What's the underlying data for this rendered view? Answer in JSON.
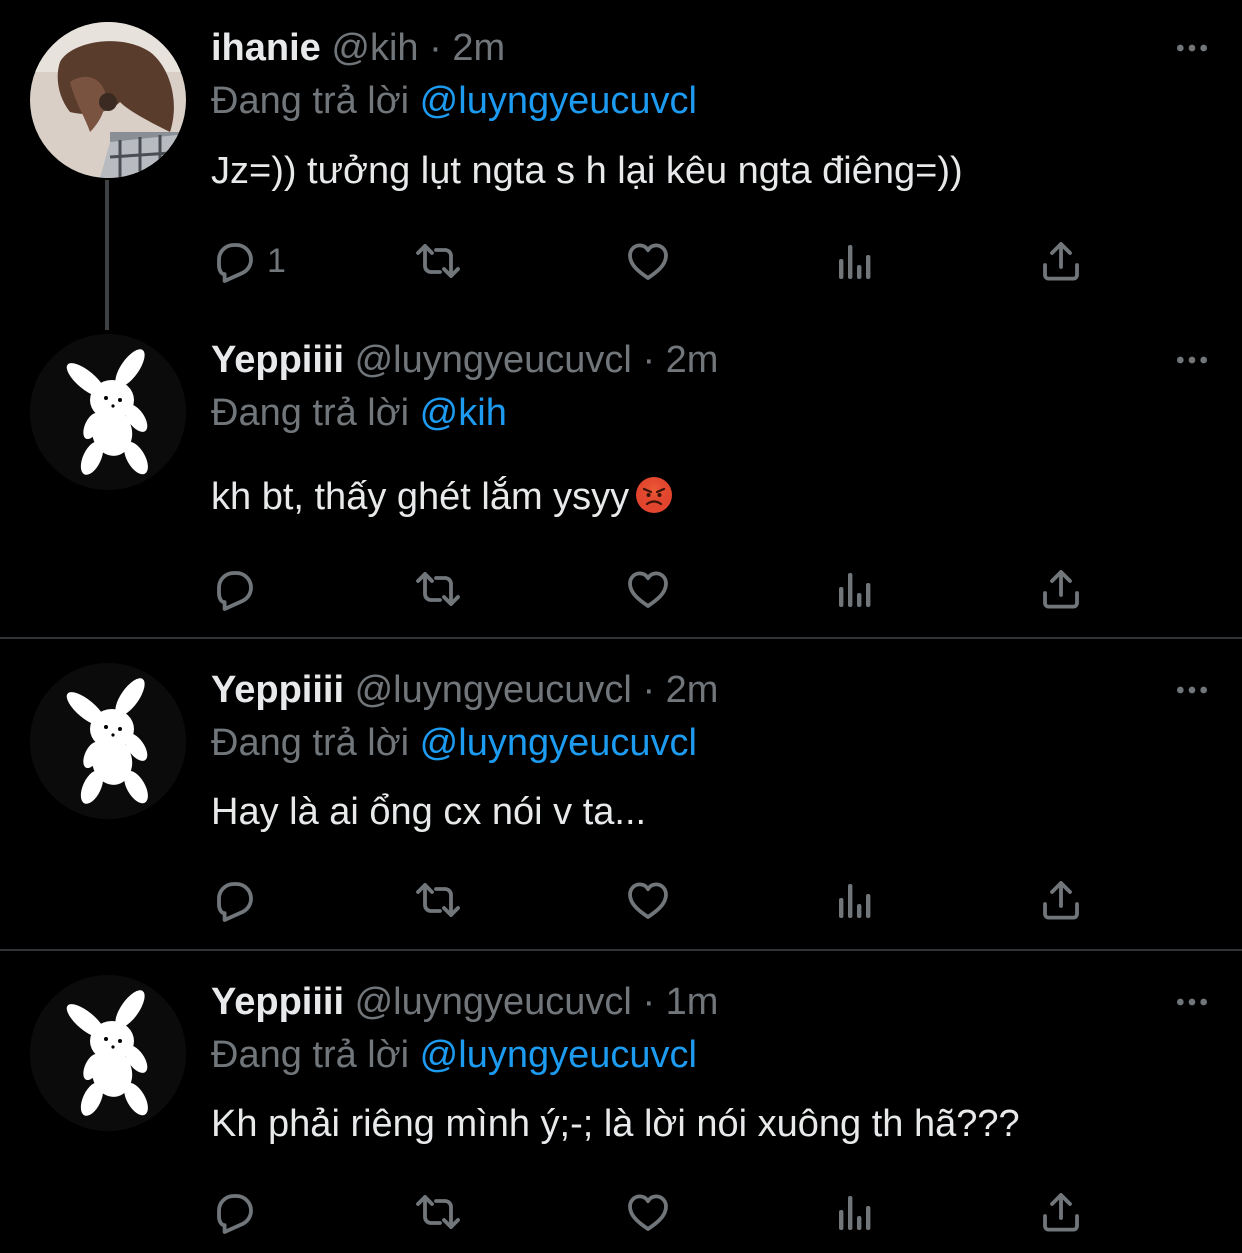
{
  "colors": {
    "background": "#000000",
    "text": "#e7e9ea",
    "muted": "#71767b",
    "mention": "#1d9bf0",
    "divider": "#2f3336"
  },
  "icons": {
    "reply": "reply-icon",
    "retweet": "retweet-icon",
    "like": "heart-icon",
    "views": "views-icon",
    "share": "share-icon",
    "more": "more-icon"
  },
  "tweets": [
    {
      "name": "ihanie",
      "handle": "@kih",
      "time": "2m",
      "reply_label": "Đang trả lời",
      "reply_to": "@luyngyeucuvcl",
      "text": "Jz=)) tưởng lụt ngta s h lại kêu ngta điêng=))",
      "reply_count": "1"
    },
    {
      "name": "Yeppiiii",
      "handle": "@luyngyeucuvcl",
      "time": "2m",
      "reply_label": "Đang trả lời",
      "reply_to": "@kih",
      "text": "kh bt, thấy ghét lắm ysyy",
      "emoji": "angry-face-emoji",
      "reply_count": ""
    },
    {
      "name": "Yeppiiii",
      "handle": "@luyngyeucuvcl",
      "time": "2m",
      "reply_label": "Đang trả lời",
      "reply_to": "@luyngyeucuvcl",
      "text": "Hay là ai ổng cx nói v ta...",
      "reply_count": ""
    },
    {
      "name": "Yeppiiii",
      "handle": "@luyngyeucuvcl",
      "time": "1m",
      "reply_label": "Đang trả lời",
      "reply_to": "@luyngyeucuvcl",
      "text": "Kh phải riêng mình ý;-; là lời nói xuông th hã???",
      "reply_count": ""
    }
  ]
}
